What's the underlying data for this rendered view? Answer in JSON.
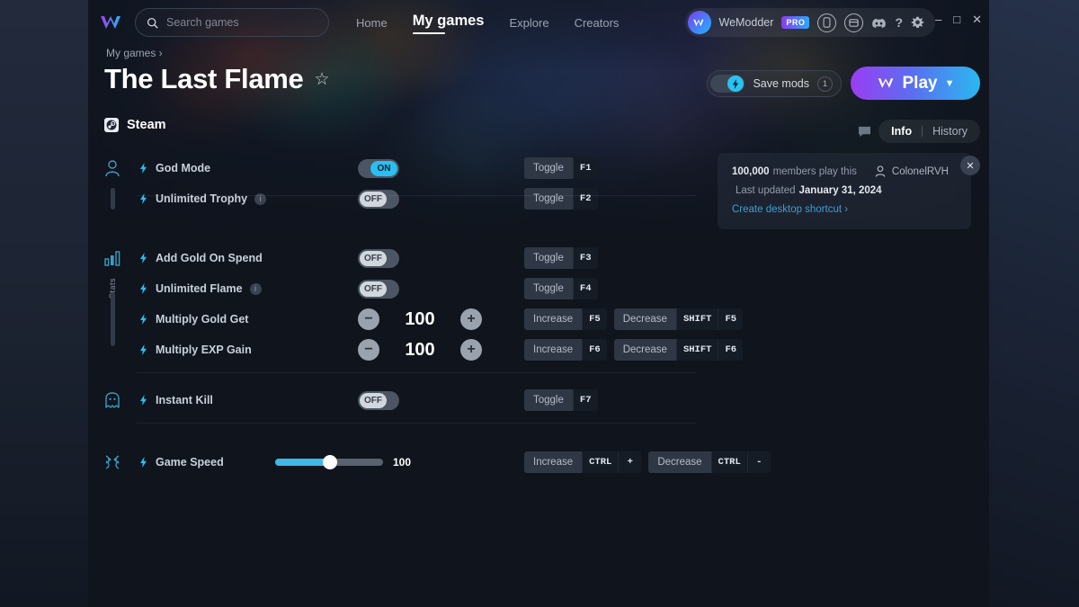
{
  "nav": {
    "logo_icon": "wemodder-logo-icon",
    "search": {
      "placeholder": "Search games",
      "value": "",
      "icon": "search-icon"
    },
    "links": [
      {
        "label": "Home",
        "active": false
      },
      {
        "label": "My games",
        "active": true
      },
      {
        "label": "Explore",
        "active": false
      },
      {
        "label": "Creators",
        "active": false
      }
    ],
    "account": {
      "name": "WeModder",
      "badge": "PRO",
      "avatar_icon": "avatar-icon",
      "icons": [
        {
          "name": "mobile-app-icon"
        },
        {
          "name": "library-box-icon"
        },
        {
          "name": "discord-icon"
        },
        {
          "name": "help-icon",
          "glyph": "?"
        },
        {
          "name": "gear-icon"
        }
      ]
    },
    "window_controls": [
      {
        "name": "minimize-button",
        "glyph": "–"
      },
      {
        "name": "maximize-button",
        "glyph": "□"
      },
      {
        "name": "close-button",
        "glyph": "✕"
      }
    ]
  },
  "header": {
    "breadcrumb": "My games ›",
    "title": "The Last Flame",
    "favorite_icon": "star-outline-icon",
    "platform": {
      "label": "Steam",
      "icon": "steam-icon"
    },
    "save_mods": {
      "label": "Save mods",
      "count": "1",
      "state": "on",
      "icon": "bolt-icon"
    },
    "play": {
      "label": "Play",
      "icon": "wemod-play-icon",
      "chevron": "⌄"
    }
  },
  "info": {
    "chat_icon": "chat-bubble-icon",
    "tabs": [
      {
        "label": "Info",
        "selected": true
      },
      {
        "label": "History",
        "selected": false
      }
    ],
    "close_label": "✕",
    "members_count": "100,000",
    "members_suffix": "members play this",
    "author": "ColonelRVH",
    "author_icon": "person-icon",
    "updated_label": "Last updated",
    "updated_date": "January 31, 2024",
    "shortcut_link": "Create desktop shortcut ›"
  },
  "colors": {
    "accent_cyan": "#2bbef0",
    "accent_link": "#3c9fd6",
    "play_gradient_start": "#9b3df2",
    "play_gradient_end": "#2ab8f0",
    "toggle_off_knob": "#d2d7de"
  },
  "groups": [
    {
      "gutter_icon": "person-icon",
      "gutter_label": "",
      "cheats": [
        {
          "name": "God Mode",
          "type": "toggle",
          "state": "ON",
          "info": false,
          "hotkeys": [
            {
              "action": "Toggle",
              "keys": [
                "F1"
              ]
            }
          ]
        },
        {
          "name": "Unlimited Trophy",
          "type": "toggle",
          "state": "OFF",
          "info": true,
          "hotkeys": [
            {
              "action": "Toggle",
              "keys": [
                "F2"
              ]
            }
          ]
        }
      ]
    },
    {
      "gutter_icon": "stats-bar-icon",
      "gutter_label": "Stats",
      "cheats": [
        {
          "name": "Add Gold On Spend",
          "type": "toggle",
          "state": "OFF",
          "info": false,
          "hotkeys": [
            {
              "action": "Toggle",
              "keys": [
                "F3"
              ]
            }
          ]
        },
        {
          "name": "Unlimited Flame",
          "type": "toggle",
          "state": "OFF",
          "info": true,
          "hotkeys": [
            {
              "action": "Toggle",
              "keys": [
                "F4"
              ]
            }
          ]
        },
        {
          "name": "Multiply Gold Get",
          "type": "stepper",
          "value": "100",
          "info": false,
          "hotkeys": [
            {
              "action": "Increase",
              "keys": [
                "F5"
              ]
            },
            {
              "action": "Decrease",
              "keys": [
                "SHIFT",
                "F5"
              ]
            }
          ]
        },
        {
          "name": "Multiply EXP Gain",
          "type": "stepper",
          "value": "100",
          "info": false,
          "hotkeys": [
            {
              "action": "Increase",
              "keys": [
                "F6"
              ]
            },
            {
              "action": "Decrease",
              "keys": [
                "SHIFT",
                "F6"
              ]
            }
          ]
        }
      ]
    },
    {
      "gutter_icon": "ghost-icon",
      "gutter_label": "",
      "cheats": [
        {
          "name": "Instant Kill",
          "type": "toggle",
          "state": "OFF",
          "info": false,
          "hotkeys": [
            {
              "action": "Toggle",
              "keys": [
                "F7"
              ]
            }
          ]
        }
      ]
    },
    {
      "gutter_icon": "speed-icon",
      "gutter_label": "",
      "cheats": [
        {
          "name": "Game Speed",
          "type": "slider",
          "value": "100",
          "fill_percent": 48,
          "info": false,
          "hotkeys": [
            {
              "action": "Increase",
              "keys": [
                "CTRL",
                "+"
              ]
            },
            {
              "action": "Decrease",
              "keys": [
                "CTRL",
                "-"
              ]
            }
          ]
        }
      ]
    }
  ]
}
